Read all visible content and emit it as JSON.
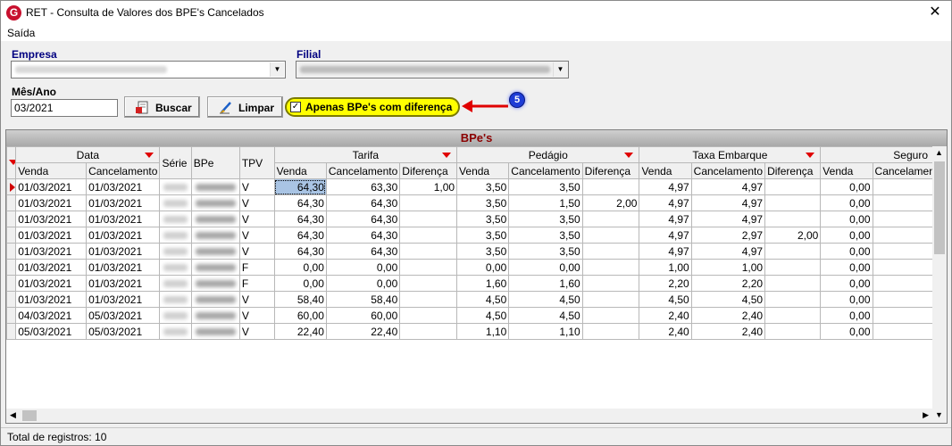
{
  "window": {
    "title": "RET - Consulta de Valores dos BPE's Cancelados",
    "close_glyph": "✕",
    "app_icon_letter": "G"
  },
  "menu": {
    "items": [
      "Saída"
    ]
  },
  "form": {
    "empresa_label": "Empresa",
    "filial_label": "Filial",
    "mes_ano_label": "Mês/Ano",
    "mes_ano_value": "03/2021",
    "buscar_label": "Buscar",
    "limpar_label": "Limpar",
    "apenas_label": "Apenas BPe's com diferença",
    "apenas_checked": true
  },
  "callout": {
    "number": "5"
  },
  "grid": {
    "caption": "BPe's",
    "group_headers": [
      "Data",
      "Série",
      "BPe",
      "TPV",
      "Tarifa",
      "Pedágio",
      "Taxa Embarque",
      "Seguro"
    ],
    "sub_headers": [
      "Venda",
      "Cancelamento",
      "Venda",
      "Cancelamento",
      "Diferença",
      "Venda",
      "Cancelamento",
      "Diferença",
      "Venda",
      "Cancelamento",
      "Diferença",
      "Venda",
      "Cancelamento"
    ],
    "rows": [
      {
        "venda": "01/03/2021",
        "canc": "01/03/2021",
        "tpv": "V",
        "t_v": "64,30",
        "t_c": "63,30",
        "t_d": "1,00",
        "p_v": "3,50",
        "p_c": "3,50",
        "p_d": "",
        "e_v": "4,97",
        "e_c": "4,97",
        "e_d": "",
        "s_v": "0,00"
      },
      {
        "venda": "01/03/2021",
        "canc": "01/03/2021",
        "tpv": "V",
        "t_v": "64,30",
        "t_c": "64,30",
        "t_d": "",
        "p_v": "3,50",
        "p_c": "1,50",
        "p_d": "2,00",
        "e_v": "4,97",
        "e_c": "4,97",
        "e_d": "",
        "s_v": "0,00"
      },
      {
        "venda": "01/03/2021",
        "canc": "01/03/2021",
        "tpv": "V",
        "t_v": "64,30",
        "t_c": "64,30",
        "t_d": "",
        "p_v": "3,50",
        "p_c": "3,50",
        "p_d": "",
        "e_v": "4,97",
        "e_c": "4,97",
        "e_d": "",
        "s_v": "0,00"
      },
      {
        "venda": "01/03/2021",
        "canc": "01/03/2021",
        "tpv": "V",
        "t_v": "64,30",
        "t_c": "64,30",
        "t_d": "",
        "p_v": "3,50",
        "p_c": "3,50",
        "p_d": "",
        "e_v": "4,97",
        "e_c": "2,97",
        "e_d": "2,00",
        "s_v": "0,00"
      },
      {
        "venda": "01/03/2021",
        "canc": "01/03/2021",
        "tpv": "V",
        "t_v": "64,30",
        "t_c": "64,30",
        "t_d": "",
        "p_v": "3,50",
        "p_c": "3,50",
        "p_d": "",
        "e_v": "4,97",
        "e_c": "4,97",
        "e_d": "",
        "s_v": "0,00"
      },
      {
        "venda": "01/03/2021",
        "canc": "01/03/2021",
        "tpv": "F",
        "t_v": "0,00",
        "t_c": "0,00",
        "t_d": "",
        "p_v": "0,00",
        "p_c": "0,00",
        "p_d": "",
        "e_v": "1,00",
        "e_c": "1,00",
        "e_d": "",
        "s_v": "0,00"
      },
      {
        "venda": "01/03/2021",
        "canc": "01/03/2021",
        "tpv": "F",
        "t_v": "0,00",
        "t_c": "0,00",
        "t_d": "",
        "p_v": "1,60",
        "p_c": "1,60",
        "p_d": "",
        "e_v": "2,20",
        "e_c": "2,20",
        "e_d": "",
        "s_v": "0,00"
      },
      {
        "venda": "01/03/2021",
        "canc": "01/03/2021",
        "tpv": "V",
        "t_v": "58,40",
        "t_c": "58,40",
        "t_d": "",
        "p_v": "4,50",
        "p_c": "4,50",
        "p_d": "",
        "e_v": "4,50",
        "e_c": "4,50",
        "e_d": "",
        "s_v": "0,00"
      },
      {
        "venda": "04/03/2021",
        "canc": "05/03/2021",
        "tpv": "V",
        "t_v": "60,00",
        "t_c": "60,00",
        "t_d": "",
        "p_v": "4,50",
        "p_c": "4,50",
        "p_d": "",
        "e_v": "2,40",
        "e_c": "2,40",
        "e_d": "",
        "s_v": "0,00"
      },
      {
        "venda": "05/03/2021",
        "canc": "05/03/2021",
        "tpv": "V",
        "t_v": "22,40",
        "t_c": "22,40",
        "t_d": "",
        "p_v": "1,10",
        "p_c": "1,10",
        "p_d": "",
        "e_v": "2,40",
        "e_c": "2,40",
        "e_d": "",
        "s_v": "0,00"
      }
    ]
  },
  "status": {
    "text": "Total de registros: 10"
  },
  "colors": {
    "caption_text": "#8b0000",
    "highlight": "#ffff00",
    "callout": "#1e3cd6",
    "indicator": "#d00000",
    "selected_cell": "#a9c4e4"
  }
}
